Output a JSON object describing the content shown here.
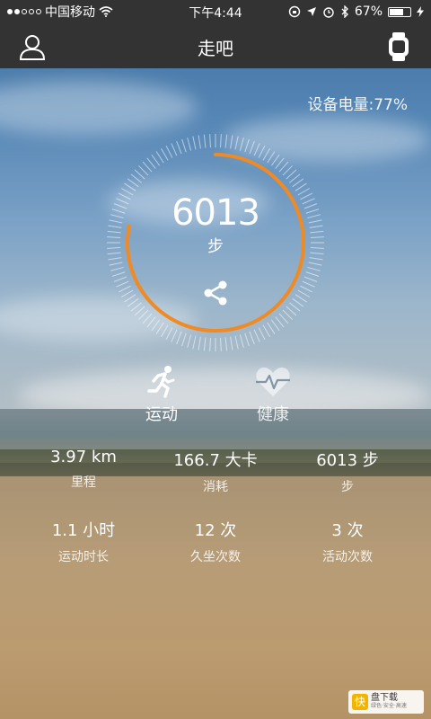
{
  "status": {
    "carrier": "中国移动",
    "time": "下午4:44",
    "battery_pct": "67%",
    "battery_level": 0.67,
    "signal_dots_filled": 2,
    "signal_dots_total": 5
  },
  "nav": {
    "title": "走吧",
    "left_icon": "profile-icon",
    "right_icon": "watch-icon"
  },
  "device_battery": "设备电量:77%",
  "steps": {
    "value": "6013",
    "unit": "步",
    "goal_progress": 0.78
  },
  "tabs": [
    {
      "label": "运动",
      "icon": "running-icon",
      "active": true
    },
    {
      "label": "健康",
      "icon": "heart-rate-icon",
      "active": false
    }
  ],
  "stats": [
    {
      "value": "3.97 km",
      "label": "里程"
    },
    {
      "value": "166.7 大卡",
      "label": "消耗"
    },
    {
      "value": "6013 步",
      "label": "步"
    },
    {
      "value": "1.1 小时",
      "label": "运动时长"
    },
    {
      "value": "12 次",
      "label": "久坐次数"
    },
    {
      "value": "3 次",
      "label": "活动次数"
    }
  ],
  "watermark": {
    "logo_char": "快",
    "text": "盘下载",
    "sub": "绿色·安全·高速"
  },
  "colors": {
    "accent": "#f08a24",
    "bar": "#333333"
  }
}
